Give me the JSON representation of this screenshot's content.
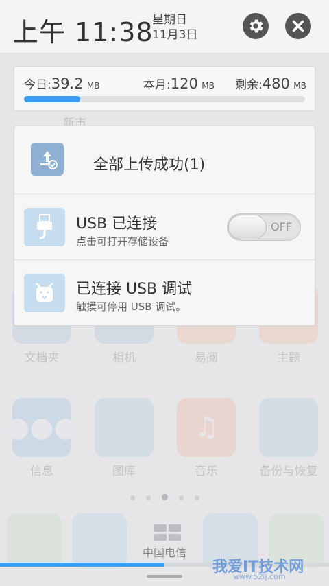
{
  "status": {
    "time": "上午 11:38",
    "weekday": "星期日",
    "date": "11月3日"
  },
  "header_icons": {
    "settings": "gear-icon",
    "close": "close-icon"
  },
  "data_usage": {
    "today_label": "今日:",
    "today_value": "39.2",
    "month_label": "本月:",
    "month_value": "120",
    "remaining_label": "剩余:",
    "remaining_value": "480",
    "unit": "MB",
    "used_fraction": 0.2,
    "accent_color": "#3c9ef2"
  },
  "notifications": [
    {
      "title": "全部上传成功(1)",
      "icon": "upload-icon"
    },
    {
      "title": "USB 已连接",
      "subtitle": "点击可打开存储设备",
      "icon": "usb-icon",
      "toggle_label": "OFF",
      "toggle_on": false
    },
    {
      "title": "已连接 USB 调试",
      "subtitle": "触摸可停用 USB 调试。",
      "icon": "android-debug-icon"
    }
  ],
  "background": {
    "top_label": "新市",
    "row1": [
      "文档夹",
      "相机",
      "易阅",
      "主题"
    ],
    "row2": [
      "信息",
      "图库",
      "音乐",
      "备份与恢复"
    ],
    "carrier": "中国电信",
    "watermark": "我爱IT技术网",
    "watermark_sub": "www.52ij.com",
    "page_dots": 5,
    "active_page": 3,
    "bottom_progress": 0.5
  }
}
